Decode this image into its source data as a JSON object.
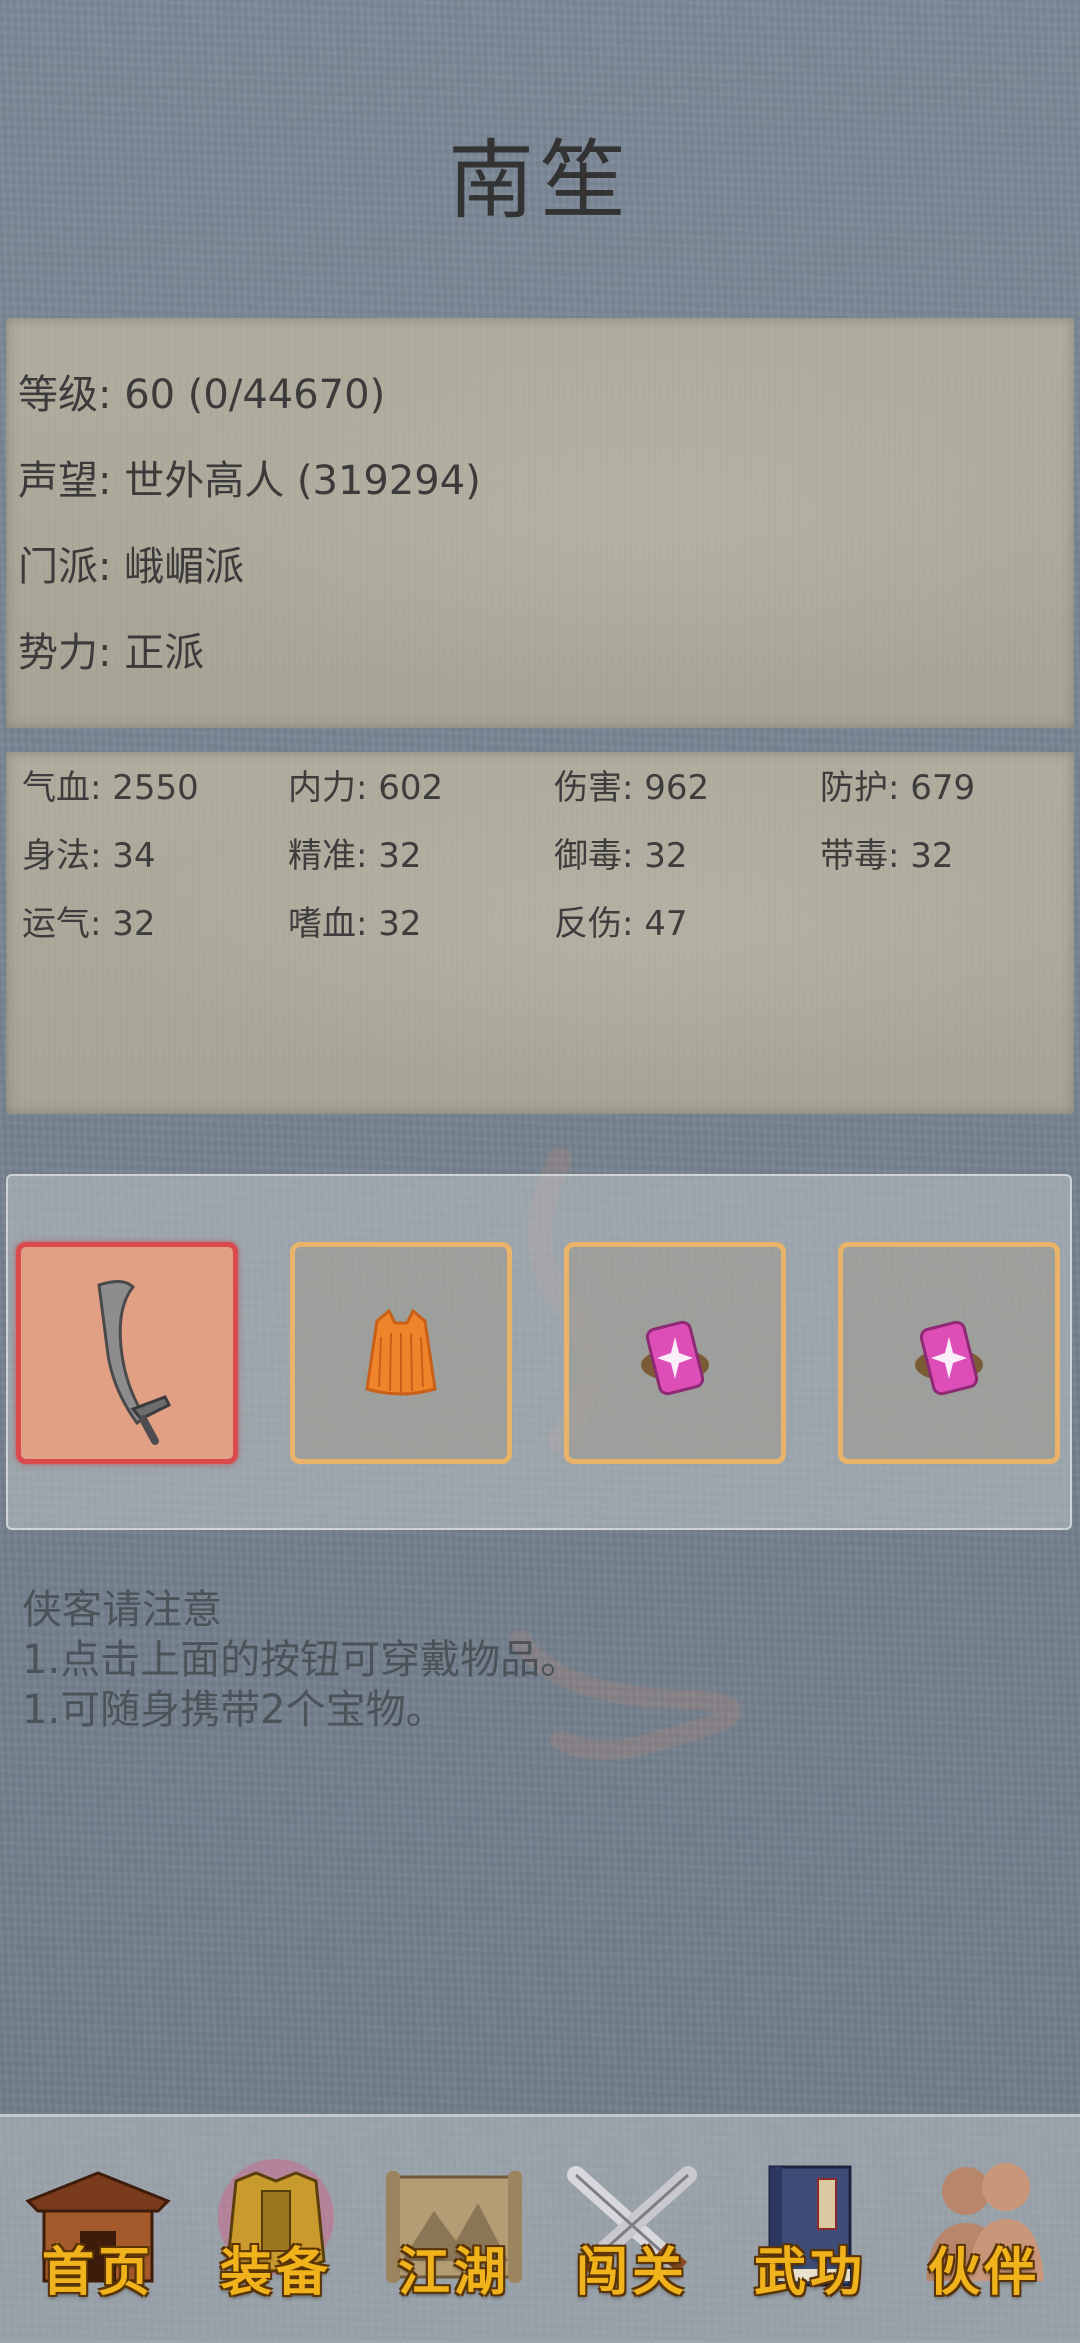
{
  "character": {
    "name": "南笙",
    "level": "等级: 60 (0/44670)",
    "reputation": "声望: 世外高人 (319294)",
    "sect": "门派: 峨嵋派",
    "faction": "势力:  正派"
  },
  "stats": [
    "气血: 2550",
    "内力: 602",
    "伤害: 962",
    "防护: 679",
    "身法: 34",
    "精准: 32",
    "御毒: 32",
    "带毒: 32",
    "运气: 32",
    "嗜血: 32",
    "反伤: 47"
  ],
  "equipment": {
    "slots": [
      {
        "icon": "sword-icon",
        "selected": true
      },
      {
        "icon": "robe-icon",
        "selected": false
      },
      {
        "icon": "treasure-gem-icon",
        "selected": false
      },
      {
        "icon": "treasure-gem-icon",
        "selected": false
      }
    ]
  },
  "notice": {
    "title": "侠客请注意",
    "lines": [
      "1.点击上面的按钮可穿戴物品。",
      "1.可随身携带2个宝物。"
    ]
  },
  "nav": [
    {
      "label": "首页",
      "icon": "house-icon"
    },
    {
      "label": "装备",
      "icon": "armor-icon",
      "active": true
    },
    {
      "label": "江湖",
      "icon": "scroll-map-icon"
    },
    {
      "label": "闯关",
      "icon": "crossed-swords-icon"
    },
    {
      "label": "武功",
      "icon": "book-icon"
    },
    {
      "label": "伙伴",
      "icon": "companions-icon"
    }
  ],
  "colors": {
    "background": "#76838f",
    "panel": "#aea999",
    "slot_border": "#e9b46a",
    "slot_active_border": "#d94a4c",
    "nav_label": "#f1b31c"
  }
}
